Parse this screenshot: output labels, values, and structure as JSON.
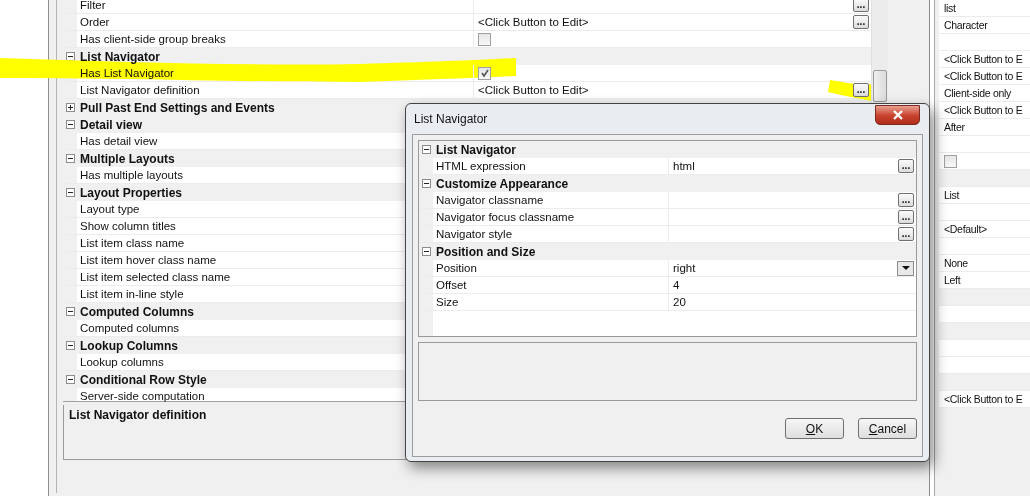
{
  "main_grid": {
    "rows": [
      {
        "kind": "ellipsis",
        "label": "Filter",
        "button": "..."
      },
      {
        "kind": "ellipsis",
        "label": "Order",
        "value": "<Click Button to Edit>",
        "button": "..."
      },
      {
        "kind": "checkbox",
        "label": "Has client-side group breaks",
        "checked": false
      },
      {
        "kind": "group",
        "label": "List Navigator",
        "expanded": true
      },
      {
        "kind": "checkbox",
        "label": "Has List Navigator",
        "checked": true
      },
      {
        "kind": "ellipsis",
        "label": "List Navigator definition",
        "value": "<Click Button to Edit>",
        "button": "..."
      },
      {
        "kind": "group",
        "label": "Pull Past End Settings and Events",
        "expanded": false
      },
      {
        "kind": "group",
        "label": "Detail view",
        "expanded": true
      },
      {
        "kind": "label",
        "label": "Has detail view"
      },
      {
        "kind": "group",
        "label": "Multiple Layouts",
        "expanded": true
      },
      {
        "kind": "label",
        "label": "Has multiple layouts"
      },
      {
        "kind": "group",
        "label": "Layout Properties",
        "expanded": true
      },
      {
        "kind": "label",
        "label": "Layout type"
      },
      {
        "kind": "label",
        "label": "Show column titles"
      },
      {
        "kind": "label",
        "label": "List item class name"
      },
      {
        "kind": "label",
        "label": "List item hover class name"
      },
      {
        "kind": "label",
        "label": "List item selected class name"
      },
      {
        "kind": "label",
        "label": "List item in-line style"
      },
      {
        "kind": "group",
        "label": "Computed Columns",
        "expanded": true
      },
      {
        "kind": "label",
        "label": "Computed columns"
      },
      {
        "kind": "group",
        "label": "Lookup Columns",
        "expanded": true
      },
      {
        "kind": "label",
        "label": "Lookup columns"
      },
      {
        "kind": "group",
        "label": "Conditional Row Style",
        "expanded": true
      },
      {
        "kind": "label",
        "label": "Server-side computation"
      }
    ]
  },
  "description": {
    "title": "List Navigator definition"
  },
  "side_grid": {
    "rows": [
      {
        "kind": "text",
        "value": "list"
      },
      {
        "kind": "text",
        "value": "Character"
      },
      {
        "kind": "empty"
      },
      {
        "kind": "text",
        "value": "<Click Button to E"
      },
      {
        "kind": "text",
        "value": "<Click Button to E"
      },
      {
        "kind": "text",
        "value": "Client-side only"
      },
      {
        "kind": "text",
        "value": "<Click Button to E"
      },
      {
        "kind": "text",
        "value": "After"
      },
      {
        "kind": "empty"
      },
      {
        "kind": "checkbox",
        "checked": false
      },
      {
        "kind": "group"
      },
      {
        "kind": "text",
        "value": "List"
      },
      {
        "kind": "empty"
      },
      {
        "kind": "text",
        "value": "<Default>"
      },
      {
        "kind": "empty"
      },
      {
        "kind": "text",
        "value": "None"
      },
      {
        "kind": "text",
        "value": "Left"
      },
      {
        "kind": "group"
      },
      {
        "kind": "empty"
      },
      {
        "kind": "group"
      },
      {
        "kind": "empty"
      },
      {
        "kind": "empty"
      },
      {
        "kind": "group"
      },
      {
        "kind": "text",
        "value": "<Click Button to E"
      }
    ]
  },
  "dialog": {
    "title": "List Navigator",
    "rows": [
      {
        "kind": "group",
        "label": "List Navigator",
        "expanded": true
      },
      {
        "kind": "ellipsis",
        "label": "HTML expression",
        "value": "html",
        "button": "..."
      },
      {
        "kind": "group",
        "label": "Customize Appearance",
        "expanded": true
      },
      {
        "kind": "ellipsis",
        "label": "Navigator classname",
        "button": "..."
      },
      {
        "kind": "ellipsis",
        "label": "Navigator focus classname",
        "button": "..."
      },
      {
        "kind": "ellipsis",
        "label": "Navigator style",
        "button": "..."
      },
      {
        "kind": "group",
        "label": "Position and Size",
        "expanded": true
      },
      {
        "kind": "dropdown",
        "label": "Position",
        "value": "right"
      },
      {
        "kind": "text",
        "label": "Offset",
        "value": "4"
      },
      {
        "kind": "text",
        "label": "Size",
        "value": "20"
      }
    ],
    "buttons": [
      {
        "label": "OK",
        "mnemonic_underlined": true
      },
      {
        "label": "Cancel",
        "mnemonic_underlined": true
      }
    ]
  }
}
